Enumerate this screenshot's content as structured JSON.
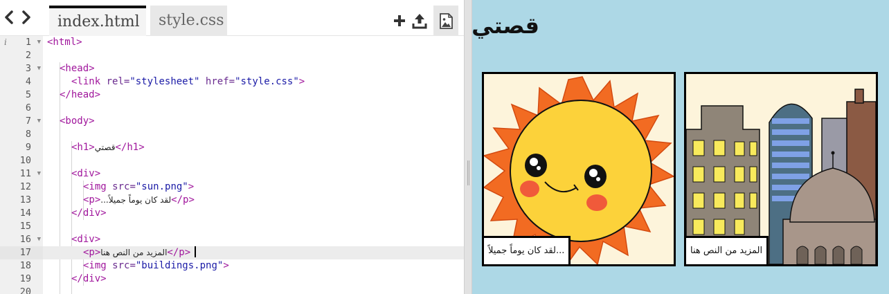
{
  "toolbar": {
    "back_icon": "chevron-left-icon",
    "forward_icon": "chevron-right-icon",
    "tabs": [
      {
        "label": "index.html",
        "active": true
      },
      {
        "label": "style.css",
        "active": false
      }
    ],
    "tools": [
      "plus-icon",
      "upload-icon",
      "image-preview-icon"
    ]
  },
  "editor": {
    "line_numbers": [
      "1",
      "2",
      "3",
      "4",
      "5",
      "6",
      "7",
      "8",
      "9",
      "10",
      "11",
      "12",
      "13",
      "14",
      "15",
      "16",
      "17",
      "18",
      "19",
      "20"
    ],
    "current_line": 17,
    "code": {
      "l1_open": "<html>",
      "l3_open": "<head>",
      "l4_tag": "<link",
      "l4_attr1": "rel=",
      "l4_val1": "\"stylesheet\"",
      "l4_attr2": "href=",
      "l4_val2": "\"style.css\"",
      "l4_close": ">",
      "l5_close": "</head>",
      "l7_open": "<body>",
      "l9_open": "<h1>",
      "l9_text": "قصتي",
      "l9_close": "</h1>",
      "l11_open": "<div>",
      "l12_tag": "<img",
      "l12_attr": "src=",
      "l12_val": "\"sun.png\"",
      "l12_close": ">",
      "l13_open": "<p>",
      "l13_text": "...لقد كان يوماً جميلاً",
      "l13_close": "</p>",
      "l14_close": "</div>",
      "l16_open": "<div>",
      "l17_open": "<p>",
      "l17_text": "المزيد من النص هنا",
      "l17_close": "</p>",
      "l18_tag": "<img",
      "l18_attr": "src=",
      "l18_val": "\"buildings.png\"",
      "l18_close": ">",
      "l19_close": "</div>"
    }
  },
  "preview": {
    "title": "قصتي",
    "panels": [
      {
        "image": "sun",
        "caption": "...لقد كان يوماً جميلاً"
      },
      {
        "image": "buildings",
        "caption": "المزيد من النص هنا"
      }
    ],
    "background_color": "#add8e6"
  },
  "colors": {
    "tag": "#a0169c",
    "attribute": "#6a2b8f",
    "string": "#1a1aa6",
    "sun_rays": "#f26b22",
    "sun_face": "#fcd23a"
  }
}
